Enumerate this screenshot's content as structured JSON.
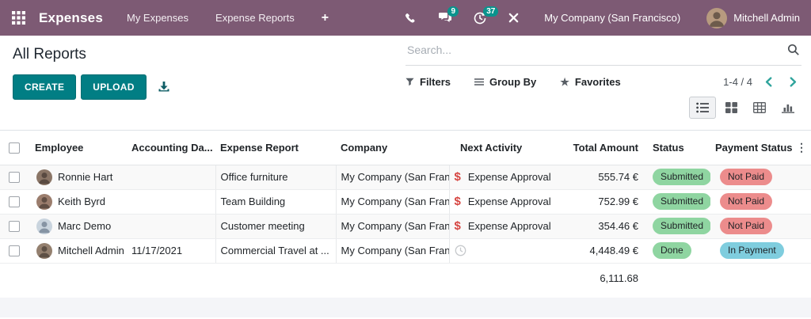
{
  "topbar": {
    "app_name": "Expenses",
    "menu_items": [
      {
        "label": "My Expenses"
      },
      {
        "label": "Expense Reports"
      }
    ],
    "plus": "+",
    "messages_badge": "9",
    "activities_badge": "37",
    "company": "My Company (San Francisco)",
    "user_name": "Mitchell Admin"
  },
  "control_panel": {
    "title": "All Reports",
    "create_button": "CREATE",
    "upload_button": "UPLOAD",
    "search_placeholder": "Search...",
    "filters": "Filters",
    "group_by": "Group By",
    "favorites": "Favorites",
    "pager": "1-4 / 4"
  },
  "table": {
    "columns": {
      "employee": "Employee",
      "accounting_date": "Accounting Da...",
      "expense_report": "Expense Report",
      "company": "Company",
      "next_activity": "Next Activity",
      "total_amount": "Total Amount",
      "status": "Status",
      "payment_status": "Payment Status"
    },
    "options_icon_glyph": "⋮",
    "activity_dollar_glyph": "$",
    "rows": [
      {
        "employee": "Ronnie Hart",
        "accounting_date": "",
        "expense_report": "Office furniture",
        "company": "My Company (San Fran...",
        "next_activity": "Expense Approval",
        "total_amount": "555.74 €",
        "status": "Submitted",
        "payment_status": "Not Paid"
      },
      {
        "employee": "Keith Byrd",
        "accounting_date": "",
        "expense_report": "Team Building",
        "company": "My Company (San Fran...",
        "next_activity": "Expense Approval",
        "total_amount": "752.99 €",
        "status": "Submitted",
        "payment_status": "Not Paid"
      },
      {
        "employee": "Marc Demo",
        "accounting_date": "",
        "expense_report": "Customer meeting",
        "company": "My Company (San Fran...",
        "next_activity": "Expense Approval",
        "total_amount": "354.46 €",
        "status": "Submitted",
        "payment_status": "Not Paid"
      },
      {
        "employee": "Mitchell Admin",
        "accounting_date": "11/17/2021",
        "expense_report": "Commercial Travel at ...",
        "company": "My Company (San Fran...",
        "next_activity": "",
        "total_amount": "4,448.49 €",
        "status": "Done",
        "payment_status": "In Payment"
      }
    ],
    "total": "6,111.68"
  },
  "colors": {
    "topbar_purple": "#7d5a74",
    "button_teal": "#017e84",
    "badge_teal": "#0a938d",
    "status_green": "#8fd5a1",
    "status_red": "#ec8c8c",
    "status_blue": "#7fcdde",
    "activity_dollar_red": "#d64541",
    "accent_teal": "#2fa49c"
  }
}
